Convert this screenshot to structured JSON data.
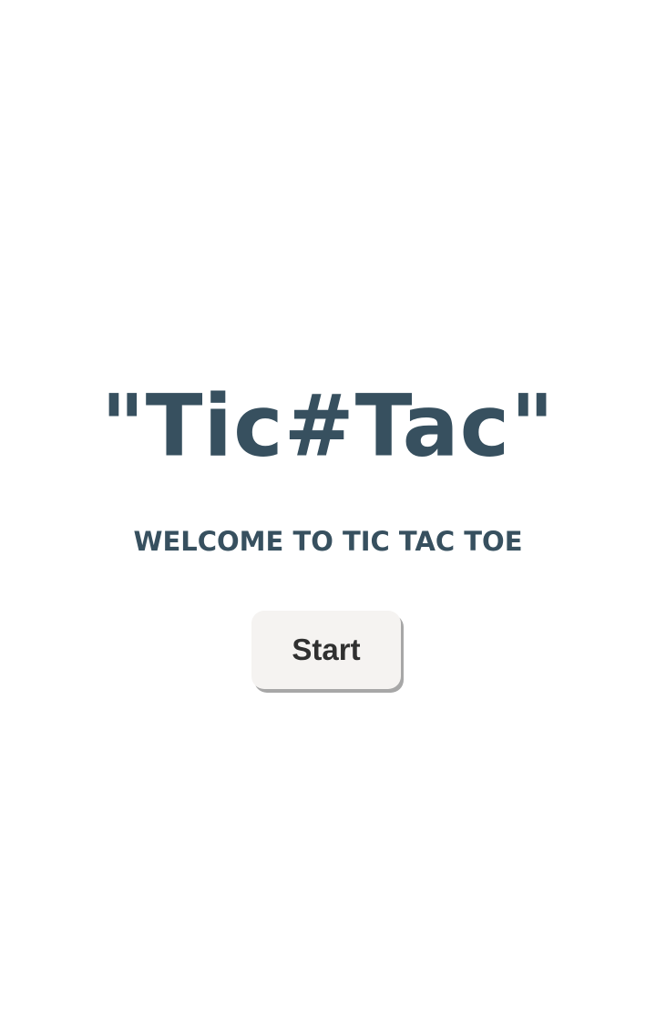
{
  "home": {
    "title": "\"Tic#Tac\"",
    "subtitle": "WELCOME TO TIC TAC TOE",
    "start_label": "Start"
  },
  "colors": {
    "background": "#ffffff",
    "title_text": "#37505f",
    "button_bg": "#f5f3f1",
    "button_text": "#303030",
    "button_shadow": "#a7a7a7"
  }
}
